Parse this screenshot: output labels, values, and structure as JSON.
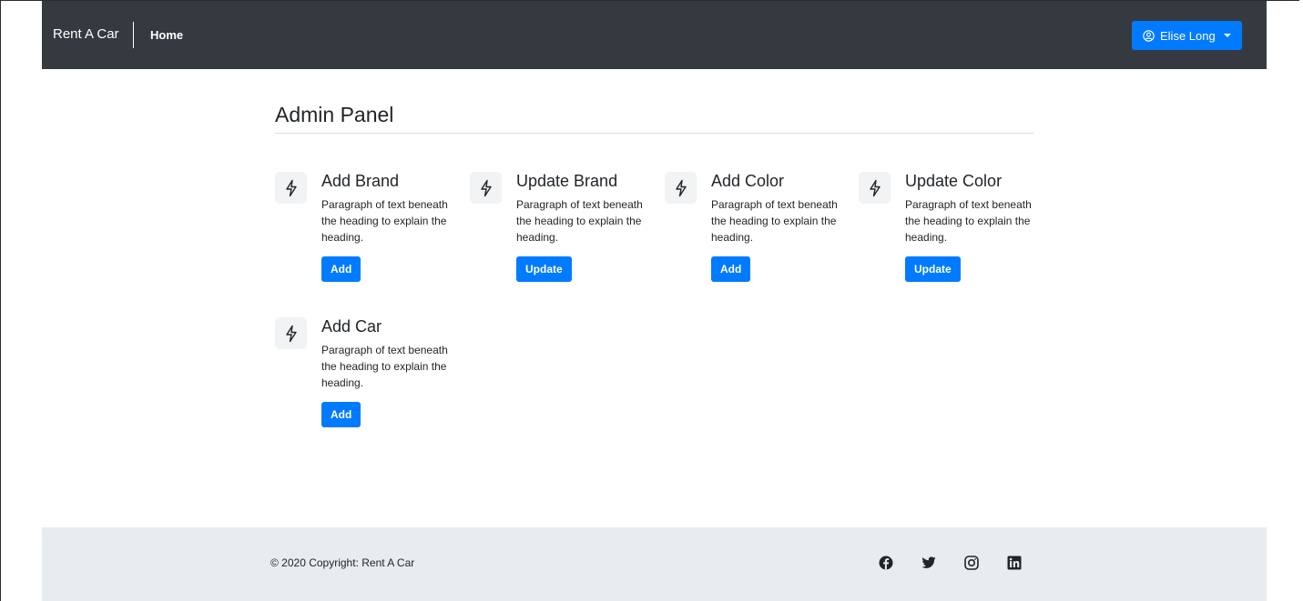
{
  "navbar": {
    "brand": "Rent A Car",
    "home_link": "Home",
    "user_menu_label": "Elise Long"
  },
  "main": {
    "title": "Admin Panel",
    "cards": [
      {
        "title": "Add Brand",
        "text": "Paragraph of text beneath the heading to explain the heading.",
        "button": "Add"
      },
      {
        "title": "Update Brand",
        "text": "Paragraph of text beneath the heading to explain the heading.",
        "button": "Update"
      },
      {
        "title": "Add Color",
        "text": "Paragraph of text beneath the heading to explain the heading.",
        "button": "Add"
      },
      {
        "title": "Update Color",
        "text": "Paragraph of text beneath the heading to explain the heading.",
        "button": "Update"
      },
      {
        "title": "Add Car",
        "text": "Paragraph of text beneath the heading to explain the heading.",
        "button": "Add"
      }
    ]
  },
  "footer": {
    "copyright": "© 2020 Copyright: Rent A Car",
    "social_icons": [
      "facebook-icon",
      "twitter-icon",
      "instagram-icon",
      "linkedin-icon"
    ]
  },
  "colors": {
    "navbar_bg": "#343a40",
    "primary": "#007bff",
    "footer_bg": "#e9ecef",
    "icon_box_bg": "#f1f3f5"
  }
}
